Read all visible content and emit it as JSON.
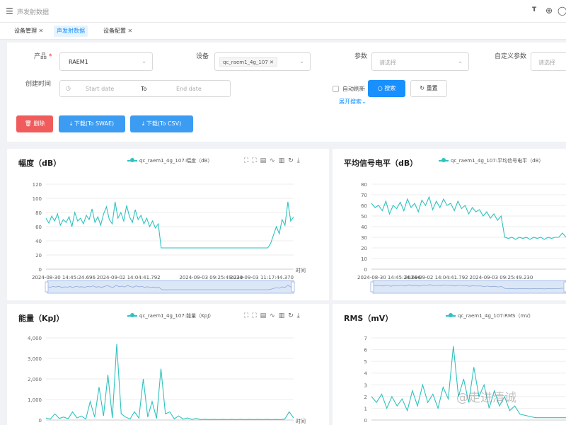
{
  "header": {
    "title": "声发射数据",
    "font_icon": "T"
  },
  "tabs": [
    {
      "label": "设备管理",
      "closable": true
    },
    {
      "label": "声发射数据",
      "active": true
    },
    {
      "label": "设备配置",
      "closable": true
    }
  ],
  "filters": {
    "product_label": "产品",
    "product_value": "RAEM1",
    "device_label": "设备",
    "device_tag": "qc_raem1_4g_107",
    "params_label": "参数",
    "params_placeholder": "请选择",
    "custom_label": "自定义参数",
    "custom_placeholder": "请选择",
    "created_label": "创建时间",
    "start_placeholder": "Start date",
    "to_text": "To",
    "end_placeholder": "End date",
    "auto_refresh_label": "自动刷新",
    "search_button": "搜索",
    "reset_button": "重置",
    "expand_link": "展开搜索"
  },
  "actions": {
    "delete_button": "删除",
    "download_swae_button": "下载(To SWAE)",
    "download_csv_button": "下载(To CSV)"
  },
  "colors": {
    "accent": "#1890ff",
    "danger": "#f05c5c",
    "series": "#2ec2bf"
  },
  "watermark": "@走进清诚",
  "chart_data": [
    {
      "type": "line",
      "title": "幅度（dB）",
      "legend": "qc_raem1_4g_107:幅度（dB）",
      "xlabel": "时间",
      "x_ticks": [
        "2024-08-30 14:45:24.696",
        "2024-09-02 14:04:41.792",
        "2024-09-03 09:25:49.230",
        "2024-09-03 11:17:44.370"
      ],
      "y_ticks": [
        "0",
        "20",
        "40",
        "60",
        "80",
        "100",
        "120"
      ],
      "ylim": [
        0,
        120
      ],
      "series": [
        {
          "values": [
            72,
            65,
            75,
            68,
            78,
            62,
            70,
            66,
            74,
            60,
            80,
            68,
            72,
            64,
            76,
            70,
            85,
            66,
            74,
            62,
            78,
            88,
            70,
            64,
            95,
            72,
            80,
            68,
            90,
            74,
            66,
            84,
            70,
            76,
            64,
            72,
            60,
            68,
            58,
            64,
            30,
            30,
            30,
            30,
            30,
            30,
            30,
            30,
            30,
            30,
            30,
            30,
            30,
            30,
            30,
            30,
            30,
            30,
            30,
            30,
            30,
            30,
            30,
            30,
            30,
            30,
            30,
            30,
            30,
            30,
            30,
            30,
            30,
            30,
            30,
            30,
            30,
            30,
            36,
            48,
            60,
            50,
            70,
            62,
            95,
            68,
            74
          ]
        }
      ],
      "tools": [
        "zoom-icon",
        "zoom-reset-icon",
        "data-view-icon",
        "line-icon",
        "bar-icon",
        "refresh-icon",
        "download-icon"
      ]
    },
    {
      "type": "line",
      "title": "平均信号电平（dB）",
      "legend": "qc_raem1_4g_107:平均信号电平（dB）",
      "xlabel": "",
      "x_ticks": [
        "2024-08-30 14:45:24.696",
        "2024-09-02 14:04:41.792",
        "2024-09-03 09:25:49.230"
      ],
      "y_ticks": [
        "0",
        "10",
        "20",
        "30",
        "40",
        "50",
        "60",
        "70",
        "80"
      ],
      "ylim": [
        0,
        80
      ],
      "series": [
        {
          "values": [
            62,
            58,
            60,
            55,
            64,
            52,
            60,
            57,
            63,
            55,
            66,
            58,
            62,
            54,
            65,
            60,
            68,
            56,
            64,
            58,
            66,
            60,
            62,
            55,
            64,
            57,
            60,
            52,
            58,
            54,
            56,
            50,
            54,
            48,
            52,
            46,
            50,
            30,
            29,
            30,
            28,
            30,
            29,
            30,
            28,
            30,
            29,
            30,
            28,
            30,
            29,
            30,
            30,
            34,
            30
          ]
        }
      ]
    },
    {
      "type": "line",
      "title": "能量（KpJ）",
      "legend": "qc_raem1_4g_107:能量（KpJ）",
      "xlabel": "时间",
      "y_ticks": [
        "0",
        "1,000",
        "2,000",
        "3,000",
        "4,000"
      ],
      "ylim": [
        0,
        4000
      ],
      "series": [
        {
          "values": [
            100,
            50,
            300,
            80,
            150,
            60,
            400,
            100,
            200,
            50,
            900,
            150,
            1600,
            200,
            2200,
            100,
            3700,
            300,
            150,
            50,
            400,
            100,
            2000,
            150,
            900,
            80,
            2500,
            300,
            400,
            60,
            200,
            50,
            100,
            30,
            80,
            20,
            40,
            20,
            30,
            20,
            30,
            20,
            30,
            20,
            30,
            20,
            30,
            20,
            30,
            20,
            30,
            20,
            30,
            20,
            50,
            400,
            100
          ]
        }
      ]
    },
    {
      "type": "line",
      "title": "RMS（mV）",
      "legend": "qc_raem1_4g_107:RMS（mV）",
      "xlabel": "",
      "y_ticks": [
        "0",
        "1",
        "2",
        "3",
        "4",
        "5",
        "6",
        "7"
      ],
      "ylim": [
        0,
        7
      ],
      "series": [
        {
          "values": [
            2,
            1.5,
            2.2,
            1,
            2,
            1.2,
            1.8,
            0.8,
            2.5,
            1.2,
            3,
            1.5,
            2.2,
            1,
            2.8,
            1.8,
            6.3,
            2,
            3.5,
            1.5,
            4.5,
            2,
            3,
            1,
            2.5,
            1.2,
            2,
            0.8,
            1.2,
            0.5,
            0.4,
            0.3,
            0.2,
            0.2,
            0.2,
            0.2,
            0.2,
            0.2,
            0.2
          ]
        }
      ]
    }
  ]
}
